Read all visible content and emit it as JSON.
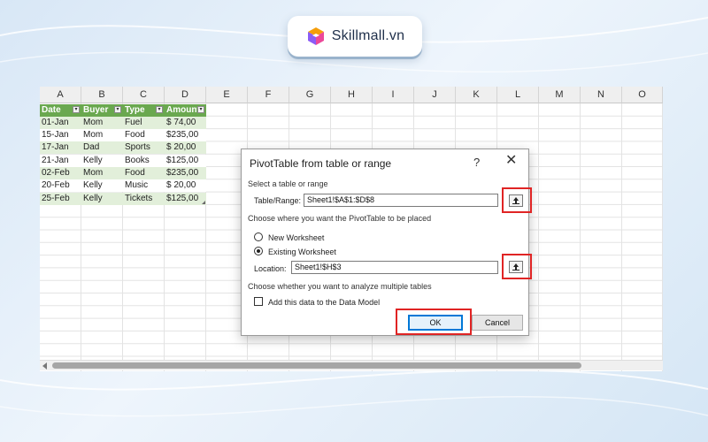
{
  "brand": {
    "name": "Skillmall.vn"
  },
  "sheet": {
    "columns": [
      "A",
      "B",
      "C",
      "D",
      "E",
      "F",
      "G",
      "H",
      "I",
      "J",
      "K",
      "L",
      "M",
      "N",
      "O"
    ],
    "table": {
      "headers": [
        "Date",
        "Buyer",
        "Type",
        "Amount"
      ],
      "rows": [
        [
          "01-Jan",
          "Mom",
          "Fuel",
          "$ 74,00"
        ],
        [
          "15-Jan",
          "Mom",
          "Food",
          "$235,00"
        ],
        [
          "17-Jan",
          "Dad",
          "Sports",
          "$ 20,00"
        ],
        [
          "21-Jan",
          "Kelly",
          "Books",
          "$125,00"
        ],
        [
          "02-Feb",
          "Mom",
          "Food",
          "$235,00"
        ],
        [
          "20-Feb",
          "Kelly",
          "Music",
          "$ 20,00"
        ],
        [
          "25-Feb",
          "Kelly",
          "Tickets",
          "$125,00"
        ]
      ]
    }
  },
  "dialog": {
    "title": "PivotTable from table or range",
    "help": "?",
    "close": "✕",
    "section_select": "Select a table or range",
    "range_label": "Table/Range:",
    "range_value": "Sheet1!$A$1:$D$8",
    "section_place": "Choose where you want the PivotTable to be placed",
    "option_new": "New Worksheet",
    "option_existing": "Existing Worksheet",
    "selected_option": "existing",
    "location_label": "Location:",
    "location_value": "Sheet1!$H$3",
    "section_multi": "Choose whether you want to analyze multiple tables",
    "data_model_label": "Add this data to the Data Model",
    "data_model_checked": false,
    "ok_label": "OK",
    "cancel_label": "Cancel"
  },
  "highlight_color": "#e02424",
  "table_header_color": "#6aa84f",
  "table_band_color": "#e2efda"
}
